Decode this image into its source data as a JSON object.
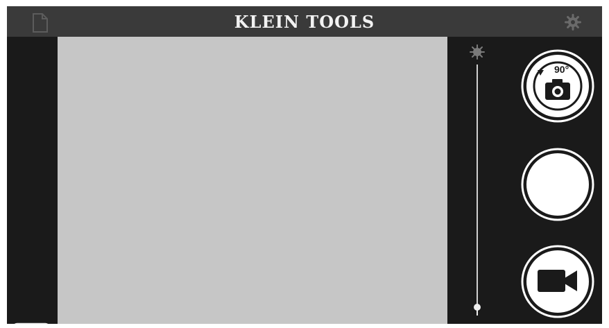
{
  "header": {
    "brand_name": "KLEIN TOOLS",
    "file_icon": "file-icon",
    "settings_icon": "gear-icon"
  },
  "sidebar_left": {
    "battery_icon": "battery-icon"
  },
  "viewfinder": {
    "background_color": "#c6c6c6"
  },
  "brightness": {
    "top_icon": "sun-icon"
  },
  "controls": {
    "rotate_capture": {
      "label": "90°",
      "icon": "camera-rotate-icon"
    },
    "shutter": {
      "icon": "circle-shutter"
    },
    "record_video": {
      "icon": "video-camera-icon"
    }
  },
  "colors": {
    "frame": "#1a1a1a",
    "header": "#3a3a3a",
    "text": "#f2f2f2"
  }
}
